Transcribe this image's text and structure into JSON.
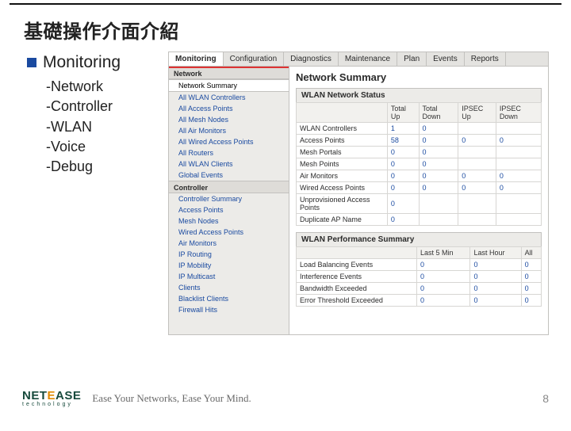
{
  "slide": {
    "title": "基礎操作介面介紹",
    "bullet": "Monitoring",
    "sublist": [
      "-Network",
      "-Controller",
      "-WLAN",
      "-Voice",
      "-Debug"
    ],
    "page_number": "8"
  },
  "footer": {
    "logo_top_leading": "NET",
    "logo_top_accent": "E",
    "logo_top_trail": "ASE",
    "logo_sub": "technology",
    "tagline": "Ease Your Networks, Ease Your Mind."
  },
  "ui": {
    "tabs": [
      "Monitoring",
      "Configuration",
      "Diagnostics",
      "Maintenance",
      "Plan",
      "Events",
      "Reports"
    ],
    "active_tab_index": 0,
    "sidebar": {
      "sections": [
        {
          "header": "Network",
          "items": [
            "Network Summary",
            "All WLAN Controllers",
            "All Access Points",
            "All Mesh Nodes",
            "All Air Monitors",
            "All Wired Access Points",
            "All Routers",
            "All WLAN Clients",
            "Global Events"
          ],
          "selected_index": 0
        },
        {
          "header": "Controller",
          "items": [
            "Controller Summary",
            "Access Points",
            "Mesh Nodes",
            "Wired Access Points",
            "Air Monitors",
            "IP Routing",
            "IP Mobility",
            "IP Multicast",
            "Clients",
            "Blacklist Clients",
            "Firewall Hits"
          ],
          "selected_index": -1
        }
      ]
    },
    "main": {
      "title": "Network Summary",
      "status": {
        "heading": "WLAN Network Status",
        "cols": [
          "",
          "Total Up",
          "Total Down",
          "IPSEC Up",
          "IPSEC Down"
        ],
        "rows": [
          {
            "label": "WLAN Controllers",
            "v": [
              "1",
              "0",
              "",
              ""
            ]
          },
          {
            "label": "Access Points",
            "v": [
              "58",
              "0",
              "0",
              "0"
            ]
          },
          {
            "label": "Mesh Portals",
            "v": [
              "0",
              "0",
              "",
              ""
            ]
          },
          {
            "label": "Mesh Points",
            "v": [
              "0",
              "0",
              "",
              ""
            ]
          },
          {
            "label": "Air Monitors",
            "v": [
              "0",
              "0",
              "0",
              "0"
            ]
          },
          {
            "label": "Wired Access Points",
            "v": [
              "0",
              "0",
              "0",
              "0"
            ]
          },
          {
            "label": "Unprovisioned Access Points",
            "v": [
              "0",
              "",
              "",
              ""
            ]
          },
          {
            "label": "Duplicate AP Name",
            "v": [
              "0",
              "",
              "",
              ""
            ]
          }
        ]
      },
      "perf": {
        "heading": "WLAN Performance Summary",
        "cols": [
          "",
          "Last 5 Min",
          "Last Hour",
          "All"
        ],
        "rows": [
          {
            "label": "Load Balancing Events",
            "v": [
              "0",
              "0",
              "0"
            ]
          },
          {
            "label": "Interference Events",
            "v": [
              "0",
              "0",
              "0"
            ]
          },
          {
            "label": "Bandwidth Exceeded",
            "v": [
              "0",
              "0",
              "0"
            ]
          },
          {
            "label": "Error Threshold Exceeded",
            "v": [
              "0",
              "0",
              "0"
            ]
          }
        ]
      }
    }
  }
}
